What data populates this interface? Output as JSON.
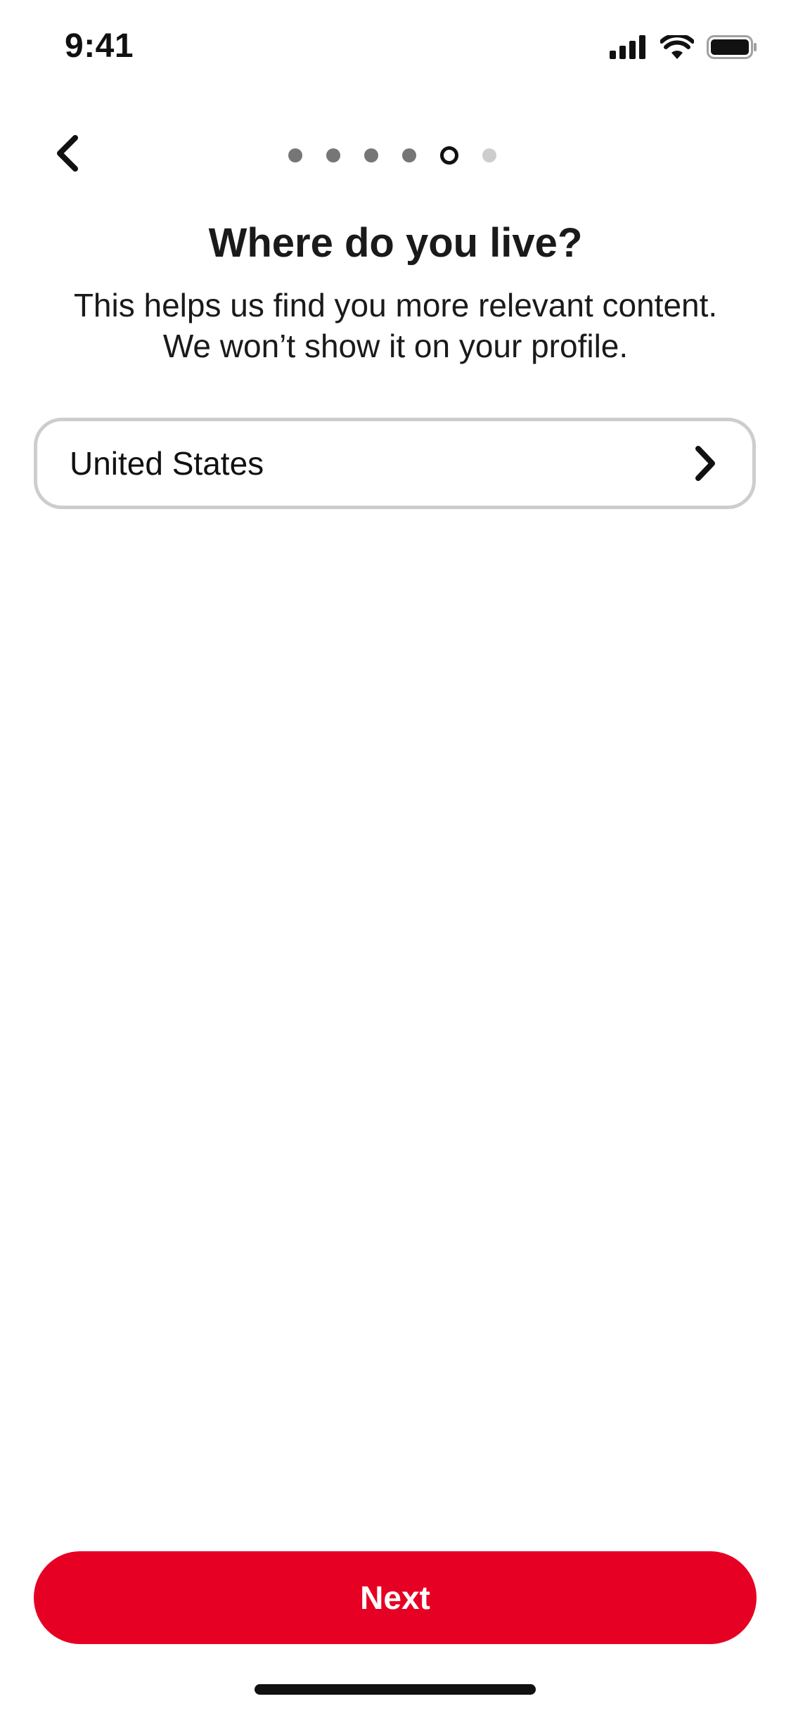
{
  "status_bar": {
    "time": "9:41",
    "icons": [
      "cellular-signal-icon",
      "wifi-icon",
      "battery-icon"
    ]
  },
  "nav": {
    "back_icon": "chevron-left-icon",
    "progress": {
      "total_steps": 6,
      "current_step": 5
    }
  },
  "header": {
    "title": "Where do you live?",
    "subtitle_line1": "This helps us find you more relevant content.",
    "subtitle_line2": "We won’t show it on your profile."
  },
  "country_selector": {
    "value": "United States",
    "icon": "chevron-right-icon"
  },
  "footer": {
    "next_label": "Next"
  },
  "colors": {
    "accent": "#e60023",
    "text": "#111111",
    "border": "#cdcdcd",
    "dot_done": "#767676",
    "dot_todo": "#cdcdcd"
  }
}
